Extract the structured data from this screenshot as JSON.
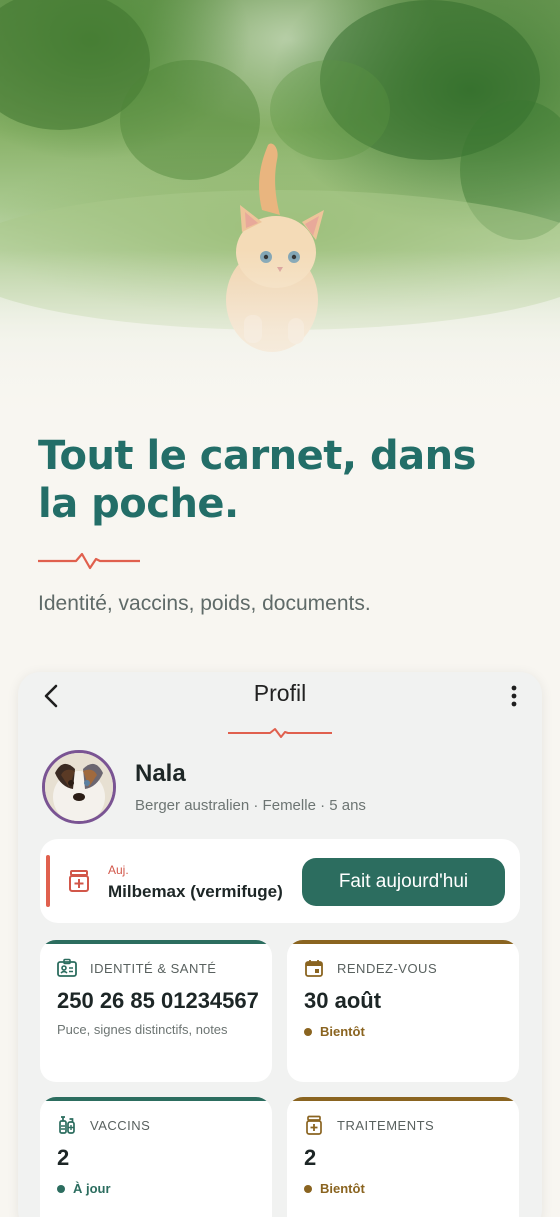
{
  "hero": {
    "headline": "Tout le carnet, dans la poche.",
    "subtitle": "Identité, vaccins, poids, documents."
  },
  "colors": {
    "brand_teal": "#236e68",
    "accent_red": "#e0604e",
    "button_green": "#2c6d5f",
    "status_green": "#2c6d5f",
    "status_brown": "#8a6420"
  },
  "profile_screen": {
    "title": "Profil",
    "back_icon": "chevron-left-icon",
    "menu_icon": "more-vertical-icon",
    "pet": {
      "name": "Nala",
      "meta": "Berger australien · Femelle · 5 ans"
    },
    "reminder": {
      "when": "Auj.",
      "text": "Milbemax (vermifuge)",
      "button": "Fait aujourd'hui",
      "icon": "medicine-box-icon"
    },
    "tiles": [
      {
        "label": "IDENTITÉ & SANTÉ",
        "value": "250 26 85 01234567",
        "sub": "Puce, signes distinctifs, notes",
        "icon": "id-card-icon"
      },
      {
        "label": "RENDEZ-VOUS",
        "value": "30 août",
        "status": "Bientôt",
        "icon": "calendar-icon"
      },
      {
        "label": "VACCINS",
        "value": "2",
        "status": "À jour",
        "icon": "syringe-icon"
      },
      {
        "label": "TRAITEMENTS",
        "value": "2",
        "status": "Bientôt",
        "icon": "medicine-box-icon"
      }
    ]
  }
}
